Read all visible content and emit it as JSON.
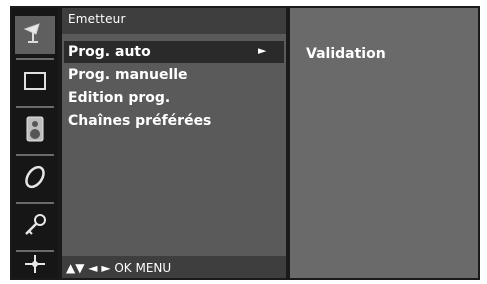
{
  "menu": {
    "title": "Emetteur",
    "items": [
      {
        "label": "Prog. auto",
        "selected": true
      },
      {
        "label": "Prog. manuelle"
      },
      {
        "label": "Edition prog."
      },
      {
        "label": "Chaînes préférées"
      }
    ],
    "selected_arrow": "►",
    "footer": "▲▼  ◄ ►  OK  MENU"
  },
  "submenu": {
    "label": "Validation"
  },
  "sidebar": {
    "icons": [
      "antenna-icon",
      "picture-icon",
      "speaker-icon",
      "clock-icon",
      "key-icon",
      "settings-icon"
    ],
    "active_index": 0
  },
  "colors": {
    "frame": "#1a1a1a",
    "menu_bg": "#5a5a5a",
    "selection": "#2a2a2a",
    "right_panel": "#6a6a6a",
    "text": "#ffffff"
  }
}
